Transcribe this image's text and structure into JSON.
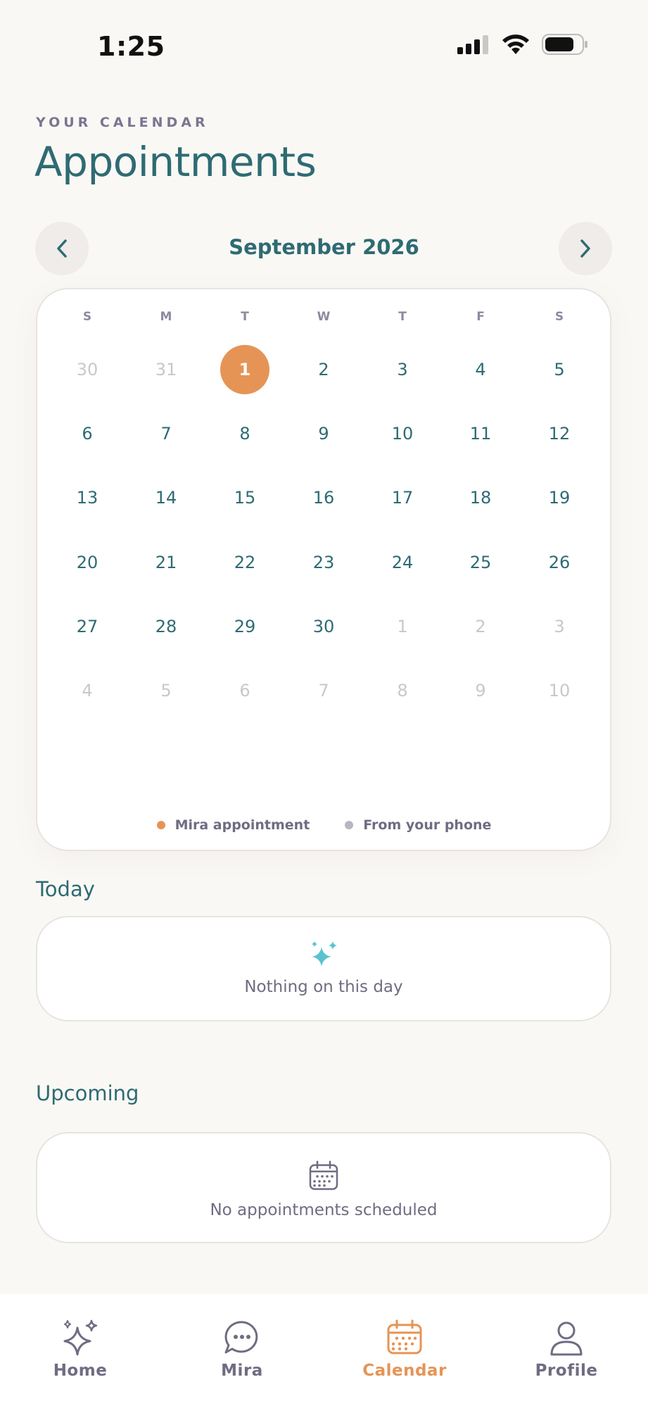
{
  "status_bar": {
    "time": "1:25"
  },
  "header": {
    "eyebrow": "YOUR CALENDAR",
    "title": "Appointments"
  },
  "calendar": {
    "month_label": "September 2026",
    "weekdays": [
      "S",
      "M",
      "T",
      "W",
      "T",
      "F",
      "S"
    ],
    "weeks": [
      [
        {
          "d": "30",
          "muted": true
        },
        {
          "d": "31",
          "muted": true
        },
        {
          "d": "1",
          "today": true
        },
        {
          "d": "2"
        },
        {
          "d": "3"
        },
        {
          "d": "4"
        },
        {
          "d": "5"
        }
      ],
      [
        {
          "d": "6"
        },
        {
          "d": "7"
        },
        {
          "d": "8"
        },
        {
          "d": "9"
        },
        {
          "d": "10"
        },
        {
          "d": "11"
        },
        {
          "d": "12"
        }
      ],
      [
        {
          "d": "13"
        },
        {
          "d": "14"
        },
        {
          "d": "15"
        },
        {
          "d": "16"
        },
        {
          "d": "17"
        },
        {
          "d": "18"
        },
        {
          "d": "19"
        }
      ],
      [
        {
          "d": "20"
        },
        {
          "d": "21"
        },
        {
          "d": "22"
        },
        {
          "d": "23"
        },
        {
          "d": "24"
        },
        {
          "d": "25"
        },
        {
          "d": "26"
        }
      ],
      [
        {
          "d": "27"
        },
        {
          "d": "28"
        },
        {
          "d": "29"
        },
        {
          "d": "30"
        },
        {
          "d": "1",
          "muted": true
        },
        {
          "d": "2",
          "muted": true
        },
        {
          "d": "3",
          "muted": true
        }
      ],
      [
        {
          "d": "4",
          "muted": true
        },
        {
          "d": "5",
          "muted": true
        },
        {
          "d": "6",
          "muted": true
        },
        {
          "d": "7",
          "muted": true
        },
        {
          "d": "8",
          "muted": true
        },
        {
          "d": "9",
          "muted": true
        },
        {
          "d": "10",
          "muted": true
        }
      ]
    ],
    "legend": [
      {
        "label": "Mira appointment",
        "color": "#E59456"
      },
      {
        "label": "From your phone",
        "color": "#B8B6C2"
      }
    ]
  },
  "today": {
    "title": "Today",
    "empty_text": "Nothing on this day"
  },
  "upcoming": {
    "title": "Upcoming",
    "empty_text": "No appointments scheduled"
  },
  "tabs": [
    {
      "label": "Home",
      "icon": "sparkles-icon",
      "active": false
    },
    {
      "label": "Mira",
      "icon": "chat-bubble-icon",
      "active": false
    },
    {
      "label": "Calendar",
      "icon": "calendar-icon",
      "active": true
    },
    {
      "label": "Profile",
      "icon": "person-icon",
      "active": false
    }
  ],
  "colors": {
    "primary": "#2E6B73",
    "accent": "#E59456",
    "muted_text": "#6F6C82",
    "sparkle": "#5BC2D0"
  }
}
